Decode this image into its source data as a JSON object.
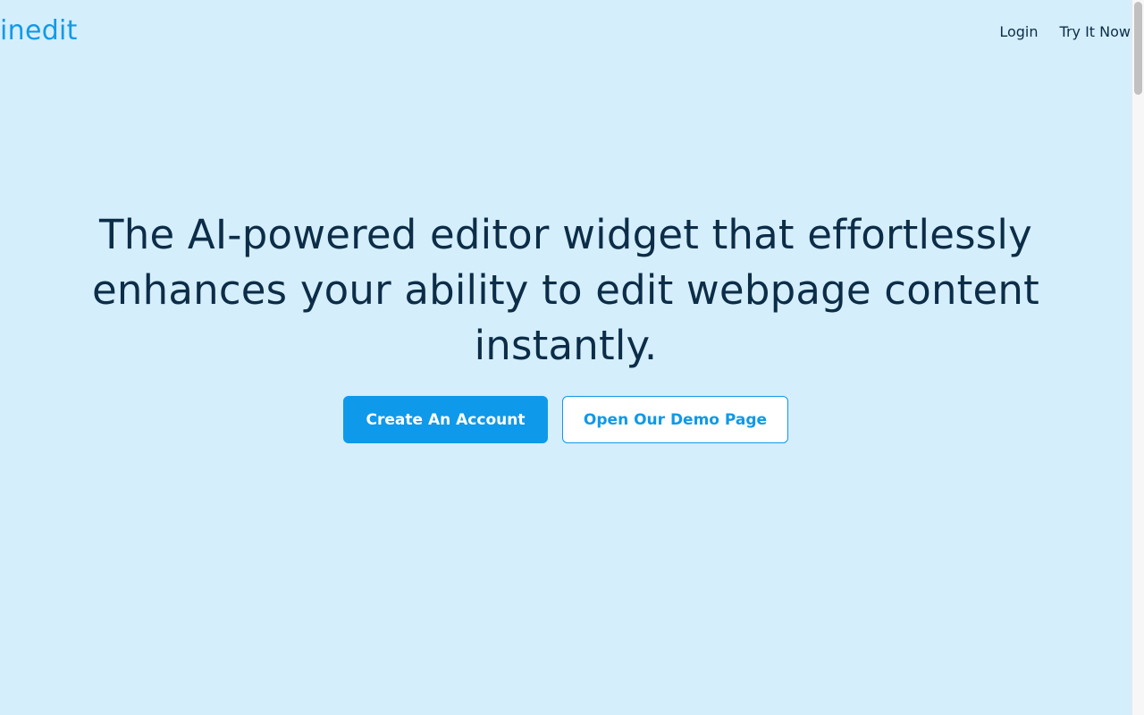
{
  "header": {
    "logo": "inedit",
    "nav": {
      "login": "Login",
      "try_it_now": "Try It Now"
    }
  },
  "hero": {
    "title": "The AI-powered editor widget that effortlessly enhances your ability to edit webpage content instantly.",
    "primary_button": "Create An Account",
    "secondary_button": "Open Our Demo Page"
  },
  "colors": {
    "background": "#d5eefc",
    "brand": "#119ae8",
    "text": "#0c2d48",
    "button_primary": "#0f99ea",
    "button_secondary_bg": "#ffffff"
  }
}
